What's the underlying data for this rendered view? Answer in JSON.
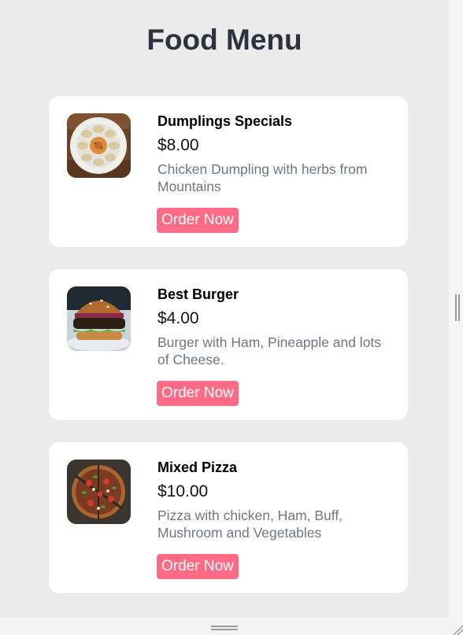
{
  "page": {
    "title": "Food Menu"
  },
  "menu": {
    "items": [
      {
        "name": "Dumplings Specials",
        "price": "$8.00",
        "description": "Chicken Dumpling with herbs from Mountains",
        "button_label": "Order Now",
        "image": "dumplings-photo"
      },
      {
        "name": "Best Burger",
        "price": "$4.00",
        "description": "Burger with Ham, Pineapple and lots of Cheese.",
        "button_label": "Order Now",
        "image": "burger-photo"
      },
      {
        "name": "Mixed Pizza",
        "price": "$10.00",
        "description": "Pizza with chicken, Ham, Buff, Mushroom and Vegetables",
        "button_label": "Order Now",
        "image": "pizza-photo"
      }
    ]
  },
  "colors": {
    "background": "#ebebeb",
    "card": "#ffffff",
    "title": "#2d3240",
    "button": "#ff6a84",
    "description": "#6f7682"
  }
}
